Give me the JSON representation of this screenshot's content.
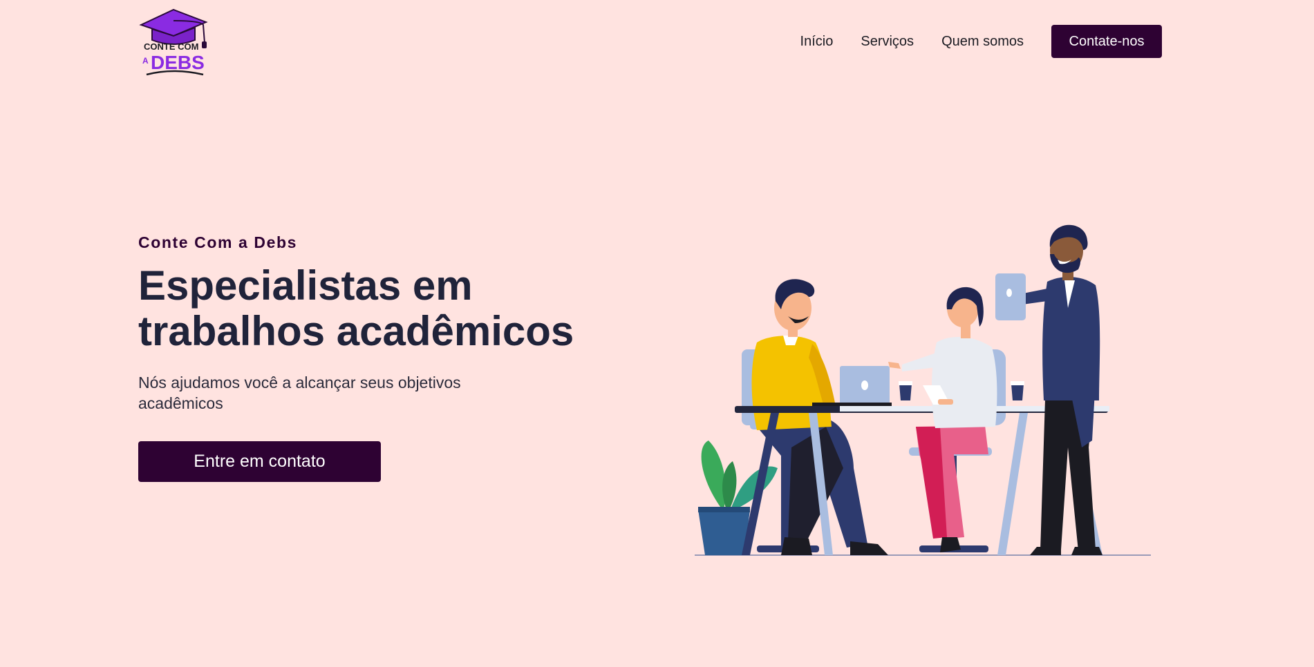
{
  "header": {
    "logo": {
      "line1": "CONTE COM",
      "line2_prefix": "A",
      "line2": "DEBS"
    },
    "nav": [
      {
        "label": "Início"
      },
      {
        "label": "Serviços"
      },
      {
        "label": "Quem somos"
      }
    ],
    "cta_label": "Contate-nos"
  },
  "hero": {
    "eyebrow": "Conte Com a Debs",
    "headline_line1": "Especialistas em",
    "headline_line2": "trabalhos acadêmicos",
    "subtext": "Nós ajudamos você a alcançar seus objetivos acadêmicos",
    "button_label": "Entre em contato"
  },
  "colors": {
    "background": "#ffe3e0",
    "brand_dark": "#2e0233",
    "logo_purple": "#8a2be2",
    "text": "#20233a"
  },
  "icons": [
    "graduation-cap-icon"
  ]
}
